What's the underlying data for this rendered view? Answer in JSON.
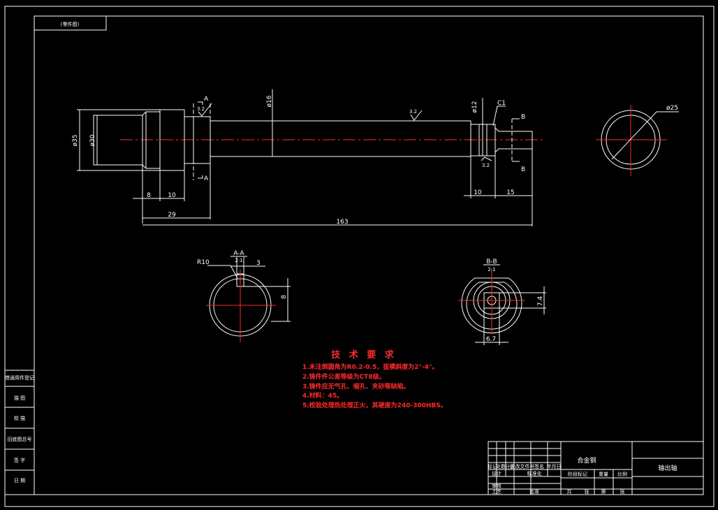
{
  "colors": {
    "background": "#000000",
    "line": "#ffffff",
    "centerline": "#ff2a2a",
    "hatch": "#19c6c6",
    "notes": "#ff2a2a"
  },
  "top_left_label": "(零件图)",
  "main_view": {
    "dims": {
      "d35": "ø35",
      "d30": "ø30",
      "d16": "ø16",
      "d12": "ø12",
      "d25": "ø25",
      "l8": "8",
      "l10a": "10",
      "l29": "29",
      "l163": "163",
      "l10b": "10",
      "l15": "15"
    },
    "chamfer": "C1",
    "roughness": [
      "3.2",
      "3.2",
      "3.2"
    ],
    "section_marks": {
      "a": "A",
      "b": "B"
    }
  },
  "section_aa": {
    "title": "A-A",
    "scale": "2:1",
    "radius": "R10",
    "key_width": "3",
    "depth": "8"
  },
  "section_bb": {
    "title": "B-B",
    "scale": "2:1",
    "height": "7.4",
    "width": "6.7"
  },
  "tech_req": {
    "title": "技 术 要 求",
    "items": [
      "1.未注倒圆角为R0.2-0.5，拔模斜度为2°-4°。",
      "2.铸件件公差等级为CT8级。",
      "3.铸件应无气孔、缩孔、夹砂等缺陷。",
      "4.材料：45。",
      "5.校验处理热处理正火，其硬度为240-300HBS。"
    ]
  },
  "left_strip": [
    "借通用件登记",
    "描 图",
    "校 描",
    "旧底图总号",
    "签 字",
    "日 期"
  ],
  "title_block": {
    "material": "合金钢",
    "part_name": "输出轴",
    "row_labels": [
      "标记",
      "处数",
      "分区",
      "更改文件号",
      "签名",
      "年月日"
    ],
    "design": "设计",
    "standardize": "标准化",
    "review": "审核",
    "process": "工艺",
    "approve": "批准",
    "stage_marks": [
      "阶段标记",
      "重量",
      "比例"
    ],
    "sheet": [
      "共",
      "张",
      "第",
      "张"
    ]
  }
}
